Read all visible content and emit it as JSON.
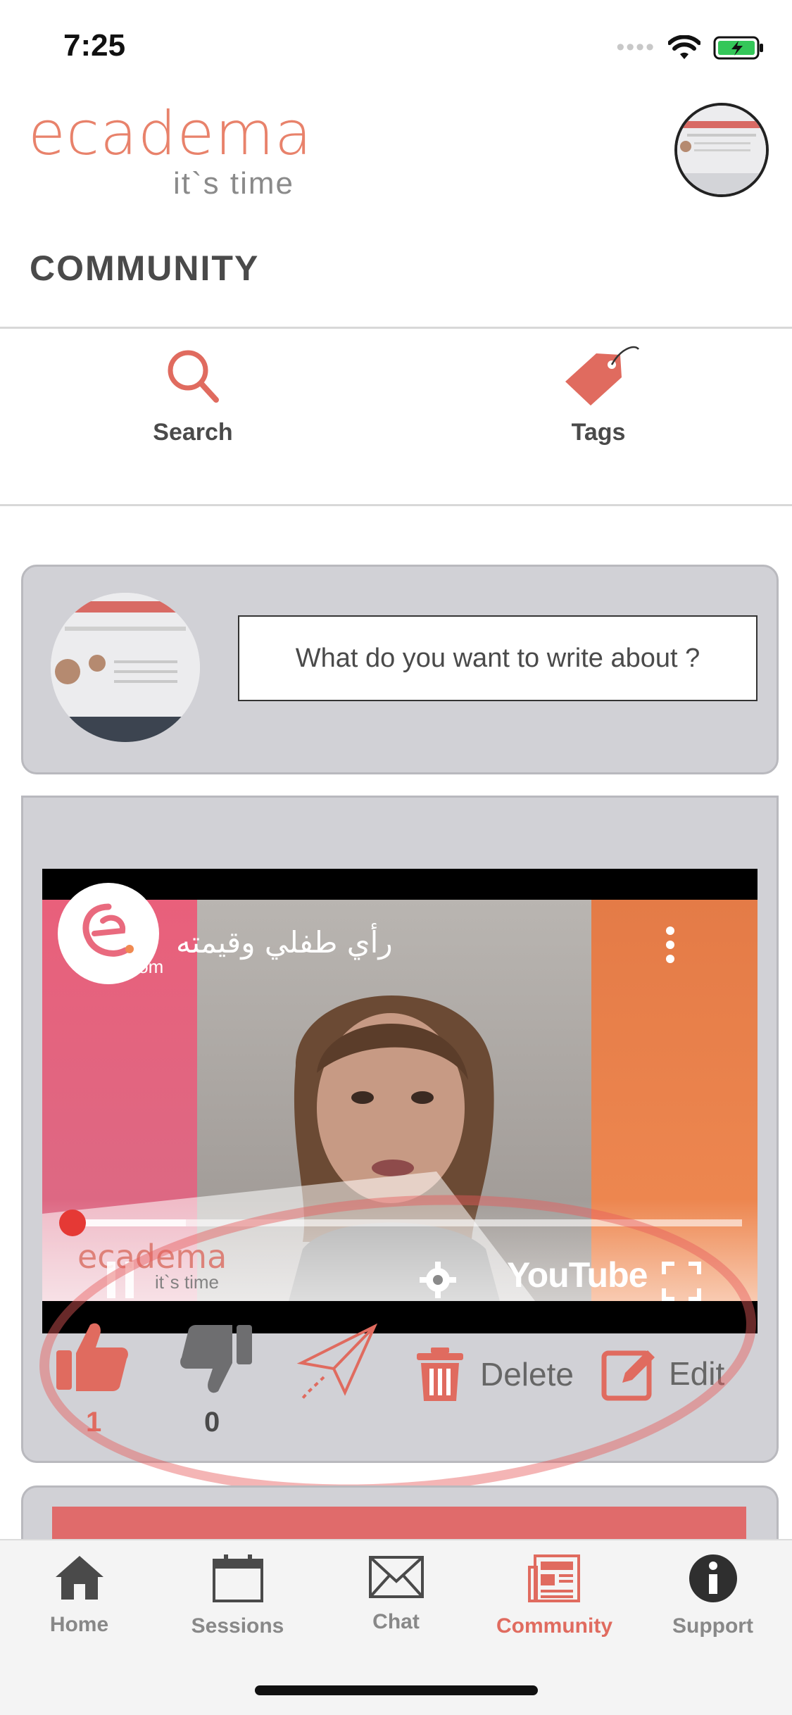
{
  "status_bar": {
    "time": "7:25"
  },
  "header": {
    "logo": "ecadema",
    "tagline": "it`s time"
  },
  "page": {
    "title": "COMMUNITY"
  },
  "quick_actions": [
    {
      "label": "Search",
      "icon": "search-icon"
    },
    {
      "label": "Tags",
      "icon": "tag-icon"
    }
  ],
  "composer": {
    "placeholder": "What do you want to write about ?"
  },
  "post": {
    "video": {
      "title": "رأي طفلي وقيمته",
      "platform": "YouTube",
      "watermark_logo": "ecadema",
      "watermark_tagline": "it`s time",
      "channel_suffix": ".com",
      "progress_fraction": 0.17
    },
    "likes": "1",
    "dislikes": "0",
    "delete_label": "Delete",
    "edit_label": "Edit"
  },
  "tabs": [
    {
      "label": "Home",
      "icon": "home-icon"
    },
    {
      "label": "Sessions",
      "icon": "calendar-icon"
    },
    {
      "label": "Chat",
      "icon": "envelope-icon"
    },
    {
      "label": "Community",
      "icon": "newspaper-icon",
      "active": true
    },
    {
      "label": "Support",
      "icon": "info-icon"
    }
  ],
  "colors": {
    "accent": "#e06b5f",
    "card": "#d1d1d6"
  }
}
